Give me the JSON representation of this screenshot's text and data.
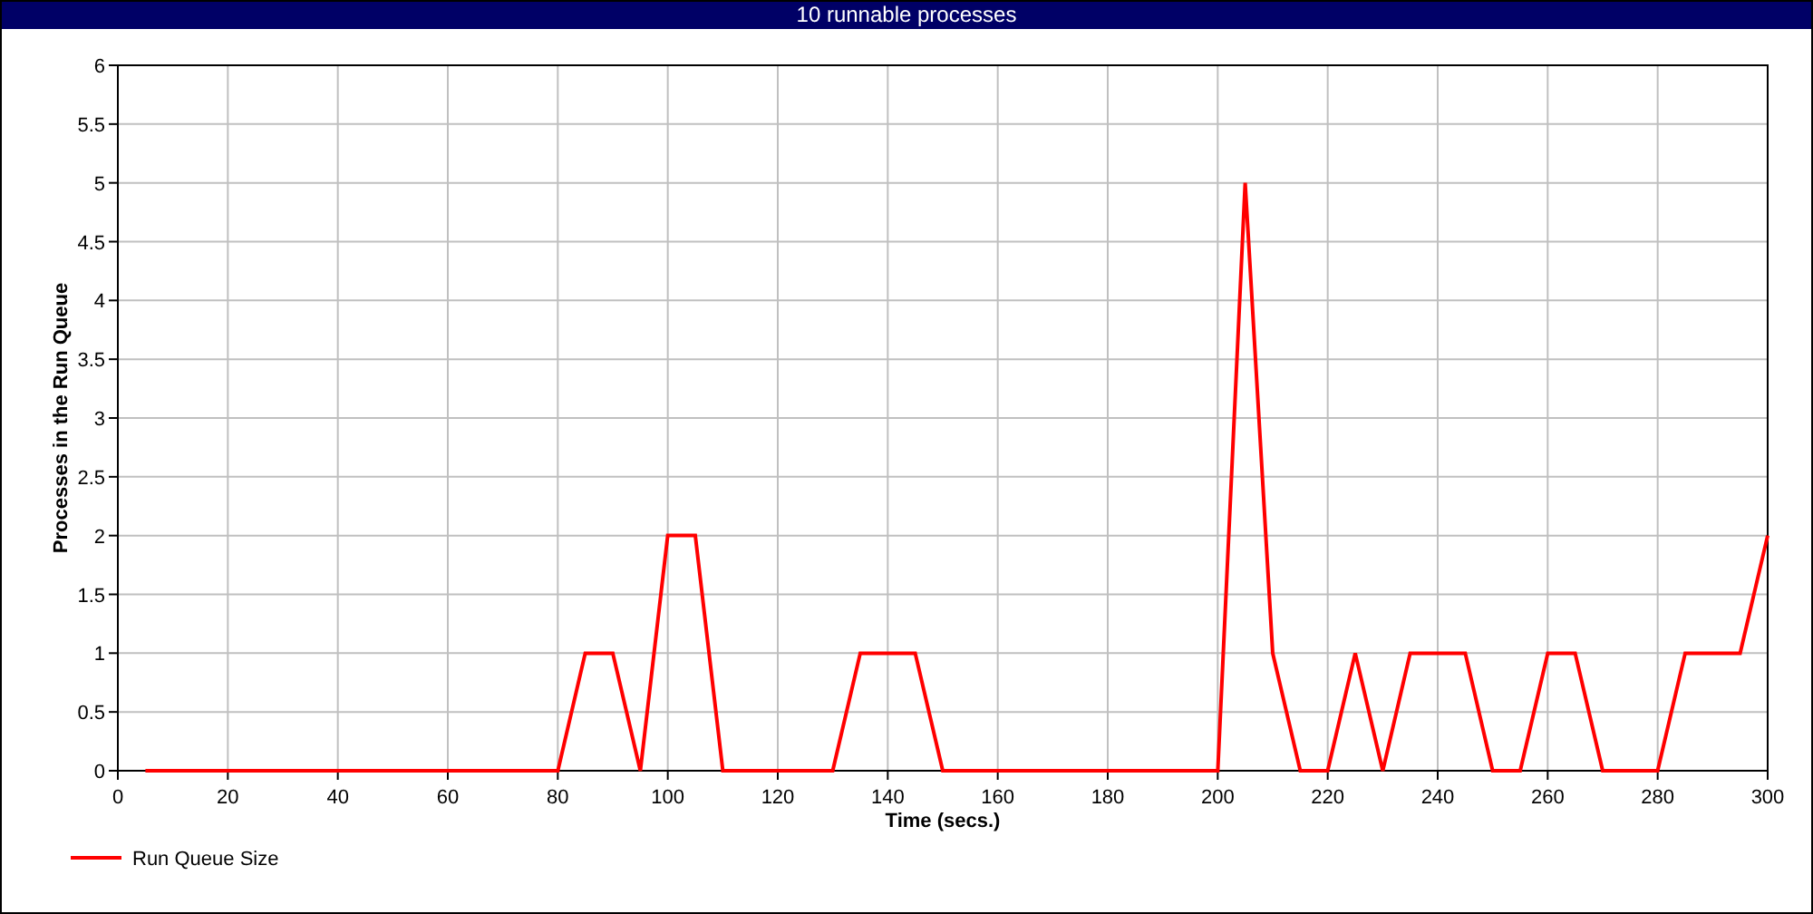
{
  "window": {
    "title": "10 runnable processes"
  },
  "chart_data": {
    "type": "line",
    "xlabel": "Time (secs.)",
    "ylabel": "Processes in the Run Queue",
    "x": [
      5,
      10,
      15,
      20,
      25,
      30,
      35,
      40,
      45,
      50,
      55,
      60,
      65,
      70,
      75,
      80,
      85,
      90,
      95,
      100,
      105,
      110,
      115,
      120,
      125,
      130,
      135,
      140,
      145,
      150,
      155,
      160,
      165,
      170,
      175,
      180,
      185,
      190,
      195,
      200,
      205,
      210,
      215,
      220,
      225,
      230,
      235,
      240,
      245,
      250,
      255,
      260,
      265,
      270,
      275,
      280,
      285,
      290,
      295,
      300
    ],
    "series": [
      {
        "name": "Run Queue Size",
        "color": "#ff0000",
        "values": [
          0,
          0,
          0,
          0,
          0,
          0,
          0,
          0,
          0,
          0,
          0,
          0,
          0,
          0,
          0,
          0,
          1,
          1,
          0,
          2,
          2,
          0,
          0,
          0,
          0,
          0,
          1,
          1,
          1,
          0,
          0,
          0,
          0,
          0,
          0,
          0,
          0,
          0,
          0,
          0,
          5,
          1,
          0,
          0,
          1,
          0,
          1,
          1,
          1,
          0,
          0,
          1,
          1,
          0,
          0,
          0,
          1,
          1,
          1,
          2
        ]
      }
    ],
    "grid": true,
    "xlim": [
      0,
      300
    ],
    "ylim": [
      0,
      6
    ],
    "xticks": [
      {
        "value": 0,
        "label": "0"
      },
      {
        "value": 20,
        "label": "20"
      },
      {
        "value": 40,
        "label": "40"
      },
      {
        "value": 60,
        "label": "60"
      },
      {
        "value": 80,
        "label": "80"
      },
      {
        "value": 100,
        "label": "100"
      },
      {
        "value": 120,
        "label": "120"
      },
      {
        "value": 140,
        "label": "140"
      },
      {
        "value": 160,
        "label": "160"
      },
      {
        "value": 180,
        "label": "180"
      },
      {
        "value": 200,
        "label": "200"
      },
      {
        "value": 220,
        "label": "220"
      },
      {
        "value": 240,
        "label": "240"
      },
      {
        "value": 260,
        "label": "260"
      },
      {
        "value": 280,
        "label": "280"
      },
      {
        "value": 300,
        "label": "300"
      }
    ],
    "yticks": [
      {
        "value": 0,
        "label": "0"
      },
      {
        "value": 0.5,
        "label": "0.5"
      },
      {
        "value": 1,
        "label": "1"
      },
      {
        "value": 1.5,
        "label": "1.5"
      },
      {
        "value": 2,
        "label": "2"
      },
      {
        "value": 2.5,
        "label": "2.5"
      },
      {
        "value": 3,
        "label": "3"
      },
      {
        "value": 3.5,
        "label": "3.5"
      },
      {
        "value": 4,
        "label": "4"
      },
      {
        "value": 4.5,
        "label": "4.5"
      },
      {
        "value": 5,
        "label": "5"
      },
      {
        "value": 5.5,
        "label": "5.5"
      },
      {
        "value": 6,
        "label": "6"
      }
    ]
  }
}
